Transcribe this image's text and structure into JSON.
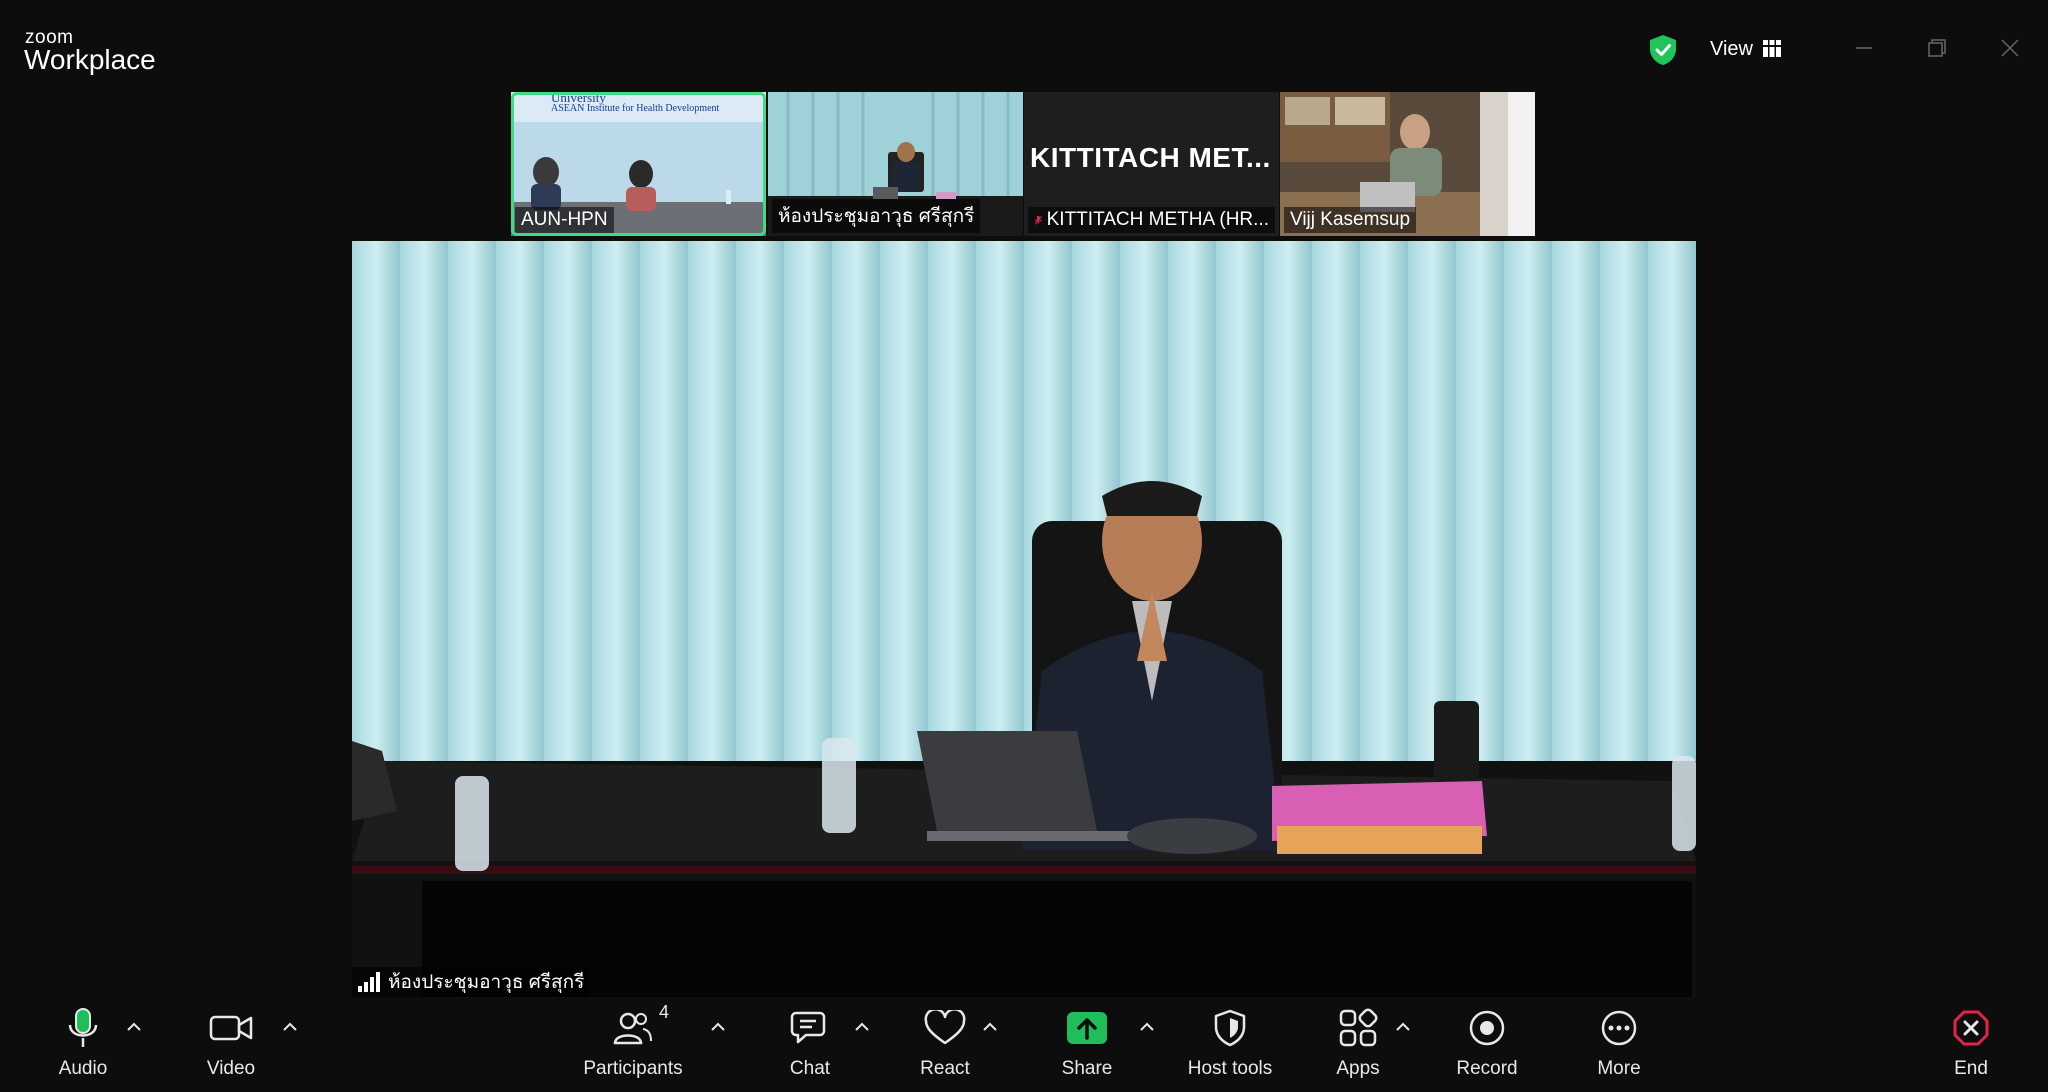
{
  "app": {
    "logo_small": "zoom",
    "logo_big": "Workplace",
    "view_label": "View"
  },
  "gallery": [
    {
      "name": "AUN-HPN",
      "banner_line1": "University",
      "banner_line2": "ASEAN Institute for Health Development",
      "active": true
    },
    {
      "name": "ห้องประชุมอาวุธ ศรีสุกรี",
      "active": false
    },
    {
      "name": "KITTITACH METHA (HR...",
      "avatar_text": "KITTITACH  MET...",
      "muted": true
    },
    {
      "name": "Vijj Kasemsup",
      "active": false
    }
  ],
  "main_video": {
    "name": "ห้องประชุมอาวุธ ศรีสุกรี"
  },
  "toolbar": {
    "audio": "Audio",
    "video": "Video",
    "participants": "Participants",
    "participants_count": "4",
    "chat": "Chat",
    "react": "React",
    "share": "Share",
    "host_tools": "Host tools",
    "apps": "Apps",
    "record": "Record",
    "more": "More",
    "end": "End"
  },
  "colors": {
    "active_speaker": "#3ddc84",
    "share_green": "#1fbe5a",
    "end_red": "#e5234a",
    "shield_green": "#21c35b"
  }
}
